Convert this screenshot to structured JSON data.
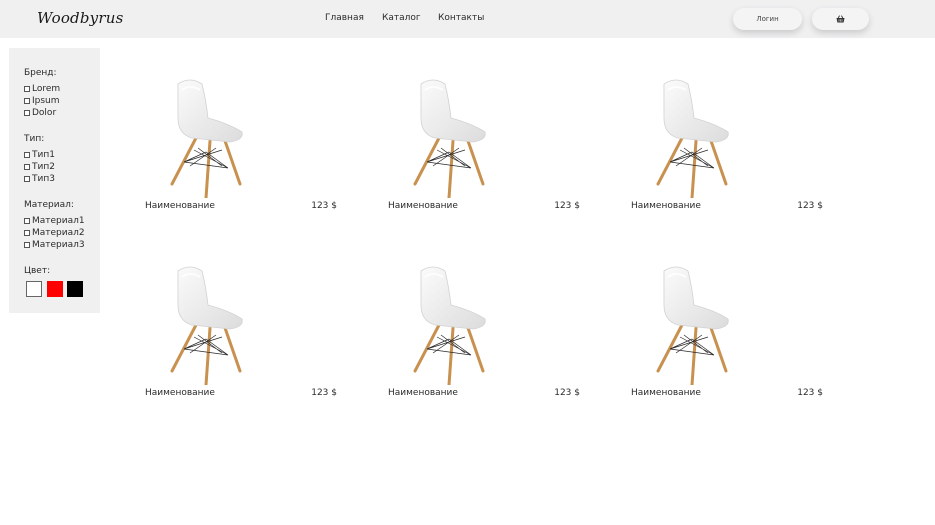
{
  "header": {
    "logo": "Woodbyrus",
    "nav": [
      "Главная",
      "Каталог",
      "Контакты"
    ],
    "login_label": "Логин",
    "cart_icon": "basket-icon"
  },
  "filters": {
    "brand": {
      "title": "Бренд:",
      "options": [
        "Lorem",
        "Ipsum",
        "Dolor"
      ]
    },
    "type": {
      "title": "Тип:",
      "options": [
        "Тип1",
        "Тип2",
        "Тип3"
      ]
    },
    "material": {
      "title": "Материал:",
      "options": [
        "Материал1",
        "Материал2",
        "Материал3"
      ]
    },
    "color": {
      "title": "Цвет:",
      "swatches": [
        "#ffffff",
        "#ff0000",
        "#000000"
      ]
    }
  },
  "products": [
    {
      "name": "Наименование",
      "price": "123 $"
    },
    {
      "name": "Наименование",
      "price": "123 $"
    },
    {
      "name": "Наименование",
      "price": "123 $"
    },
    {
      "name": "Наименование",
      "price": "123 $"
    },
    {
      "name": "Наименование",
      "price": "123 $"
    },
    {
      "name": "Наименование",
      "price": "123 $"
    }
  ]
}
